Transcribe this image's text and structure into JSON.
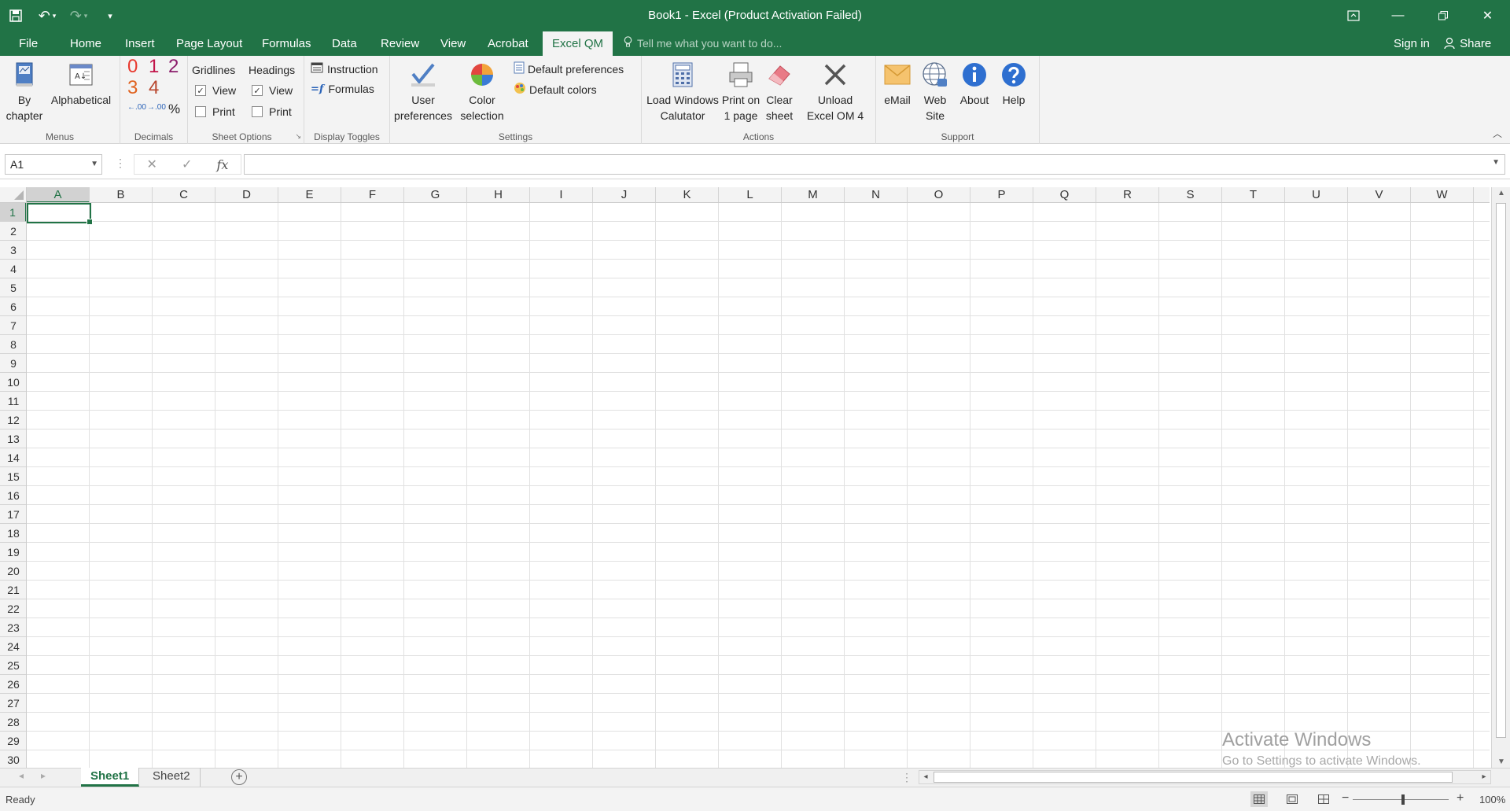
{
  "titlebar": {
    "title": "Book1 - Excel (Product Activation Failed)",
    "qat": [
      "save-icon",
      "undo-icon",
      "redo-icon",
      "customize-icon"
    ]
  },
  "tabs": [
    "File",
    "Home",
    "Insert",
    "Page Layout",
    "Formulas",
    "Data",
    "Review",
    "View",
    "Acrobat",
    "Excel QM"
  ],
  "active_tab": "Excel QM",
  "tellme": "Tell me what you want to do...",
  "signin": "Sign in",
  "share": "Share",
  "ribbon": {
    "menus": {
      "by_chapter": "By chapter",
      "alphabetical": "Alphabetical",
      "label": "Menus"
    },
    "decimals": {
      "d0": "0",
      "d1": "1",
      "d2": "2",
      "d3": "3",
      "d4": "4",
      "inc": ".00",
      "dec": ".00",
      "pct": "%",
      "label": "Decimals"
    },
    "sheet_options": {
      "gridlines": "Gridlines",
      "headings": "Headings",
      "view": "View",
      "print": "Print",
      "gridlines_view": true,
      "gridlines_print": false,
      "headings_view": true,
      "headings_print": false,
      "label": "Sheet Options"
    },
    "display_toggles": {
      "instruction": "Instruction",
      "formulas": "Formulas",
      "label": "Display Toggles"
    },
    "settings": {
      "user_prefs_l1": "User",
      "user_prefs_l2": "preferences",
      "color_l1": "Color",
      "color_l2": "selection",
      "default_prefs": "Default preferences",
      "default_colors": "Default colors",
      "label": "Settings"
    },
    "actions": {
      "load_l1": "Load Windows",
      "load_l2": "Calutator",
      "print_l1": "Print on",
      "print_l2": "1 page",
      "clear_l1": "Clear",
      "clear_l2": "sheet",
      "unload_l1": "Unload",
      "unload_l2": "Excel OM 4",
      "label": "Actions"
    },
    "support": {
      "email": "eMail",
      "web_l1": "Web",
      "web_l2": "Site",
      "about": "About",
      "help": "Help",
      "label": "Support"
    }
  },
  "formula_bar": {
    "name_box": "A1",
    "formula": ""
  },
  "columns": [
    "A",
    "B",
    "C",
    "D",
    "E",
    "F",
    "G",
    "H",
    "I",
    "J",
    "K",
    "L",
    "M",
    "N",
    "O",
    "P",
    "Q",
    "R",
    "S",
    "T",
    "U",
    "V",
    "W"
  ],
  "rows": [
    "1",
    "2",
    "3",
    "4",
    "5",
    "6",
    "7",
    "8",
    "9",
    "10",
    "11",
    "12",
    "13",
    "14",
    "15",
    "16",
    "17",
    "18",
    "19",
    "20",
    "21",
    "22",
    "23",
    "24",
    "25",
    "26",
    "27",
    "28",
    "29",
    "30"
  ],
  "watermark": {
    "line1": "Activate Windows",
    "line2": "Go to Settings to activate Windows."
  },
  "sheets": [
    "Sheet1",
    "Sheet2"
  ],
  "active_sheet": "Sheet1",
  "status": {
    "ready": "Ready",
    "zoom": "100%"
  }
}
